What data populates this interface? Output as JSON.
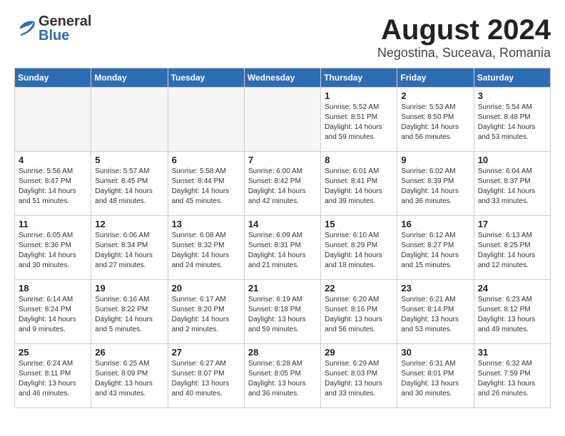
{
  "header": {
    "logo_general": "General",
    "logo_blue": "Blue",
    "month_year": "August 2024",
    "location": "Negostina, Suceava, Romania"
  },
  "weekdays": [
    "Sunday",
    "Monday",
    "Tuesday",
    "Wednesday",
    "Thursday",
    "Friday",
    "Saturday"
  ],
  "weeks": [
    [
      {
        "day": "",
        "info": ""
      },
      {
        "day": "",
        "info": ""
      },
      {
        "day": "",
        "info": ""
      },
      {
        "day": "",
        "info": ""
      },
      {
        "day": "1",
        "info": "Sunrise: 5:52 AM\nSunset: 8:51 PM\nDaylight: 14 hours\nand 59 minutes."
      },
      {
        "day": "2",
        "info": "Sunrise: 5:53 AM\nSunset: 8:50 PM\nDaylight: 14 hours\nand 56 minutes."
      },
      {
        "day": "3",
        "info": "Sunrise: 5:54 AM\nSunset: 8:48 PM\nDaylight: 14 hours\nand 53 minutes."
      }
    ],
    [
      {
        "day": "4",
        "info": "Sunrise: 5:56 AM\nSunset: 8:47 PM\nDaylight: 14 hours\nand 51 minutes."
      },
      {
        "day": "5",
        "info": "Sunrise: 5:57 AM\nSunset: 8:45 PM\nDaylight: 14 hours\nand 48 minutes."
      },
      {
        "day": "6",
        "info": "Sunrise: 5:58 AM\nSunset: 8:44 PM\nDaylight: 14 hours\nand 45 minutes."
      },
      {
        "day": "7",
        "info": "Sunrise: 6:00 AM\nSunset: 8:42 PM\nDaylight: 14 hours\nand 42 minutes."
      },
      {
        "day": "8",
        "info": "Sunrise: 6:01 AM\nSunset: 8:41 PM\nDaylight: 14 hours\nand 39 minutes."
      },
      {
        "day": "9",
        "info": "Sunrise: 6:02 AM\nSunset: 8:39 PM\nDaylight: 14 hours\nand 36 minutes."
      },
      {
        "day": "10",
        "info": "Sunrise: 6:04 AM\nSunset: 8:37 PM\nDaylight: 14 hours\nand 33 minutes."
      }
    ],
    [
      {
        "day": "11",
        "info": "Sunrise: 6:05 AM\nSunset: 8:36 PM\nDaylight: 14 hours\nand 30 minutes."
      },
      {
        "day": "12",
        "info": "Sunrise: 6:06 AM\nSunset: 8:34 PM\nDaylight: 14 hours\nand 27 minutes."
      },
      {
        "day": "13",
        "info": "Sunrise: 6:08 AM\nSunset: 8:32 PM\nDaylight: 14 hours\nand 24 minutes."
      },
      {
        "day": "14",
        "info": "Sunrise: 6:09 AM\nSunset: 8:31 PM\nDaylight: 14 hours\nand 21 minutes."
      },
      {
        "day": "15",
        "info": "Sunrise: 6:10 AM\nSunset: 8:29 PM\nDaylight: 14 hours\nand 18 minutes."
      },
      {
        "day": "16",
        "info": "Sunrise: 6:12 AM\nSunset: 8:27 PM\nDaylight: 14 hours\nand 15 minutes."
      },
      {
        "day": "17",
        "info": "Sunrise: 6:13 AM\nSunset: 8:25 PM\nDaylight: 14 hours\nand 12 minutes."
      }
    ],
    [
      {
        "day": "18",
        "info": "Sunrise: 6:14 AM\nSunset: 8:24 PM\nDaylight: 14 hours\nand 9 minutes."
      },
      {
        "day": "19",
        "info": "Sunrise: 6:16 AM\nSunset: 8:22 PM\nDaylight: 14 hours\nand 5 minutes."
      },
      {
        "day": "20",
        "info": "Sunrise: 6:17 AM\nSunset: 8:20 PM\nDaylight: 14 hours\nand 2 minutes."
      },
      {
        "day": "21",
        "info": "Sunrise: 6:19 AM\nSunset: 8:18 PM\nDaylight: 13 hours\nand 59 minutes."
      },
      {
        "day": "22",
        "info": "Sunrise: 6:20 AM\nSunset: 8:16 PM\nDaylight: 13 hours\nand 56 minutes."
      },
      {
        "day": "23",
        "info": "Sunrise: 6:21 AM\nSunset: 8:14 PM\nDaylight: 13 hours\nand 53 minutes."
      },
      {
        "day": "24",
        "info": "Sunrise: 6:23 AM\nSunset: 8:12 PM\nDaylight: 13 hours\nand 49 minutes."
      }
    ],
    [
      {
        "day": "25",
        "info": "Sunrise: 6:24 AM\nSunset: 8:11 PM\nDaylight: 13 hours\nand 46 minutes."
      },
      {
        "day": "26",
        "info": "Sunrise: 6:25 AM\nSunset: 8:09 PM\nDaylight: 13 hours\nand 43 minutes."
      },
      {
        "day": "27",
        "info": "Sunrise: 6:27 AM\nSunset: 8:07 PM\nDaylight: 13 hours\nand 40 minutes."
      },
      {
        "day": "28",
        "info": "Sunrise: 6:28 AM\nSunset: 8:05 PM\nDaylight: 13 hours\nand 36 minutes."
      },
      {
        "day": "29",
        "info": "Sunrise: 6:29 AM\nSunset: 8:03 PM\nDaylight: 13 hours\nand 33 minutes."
      },
      {
        "day": "30",
        "info": "Sunrise: 6:31 AM\nSunset: 8:01 PM\nDaylight: 13 hours\nand 30 minutes."
      },
      {
        "day": "31",
        "info": "Sunrise: 6:32 AM\nSunset: 7:59 PM\nDaylight: 13 hours\nand 26 minutes."
      }
    ]
  ]
}
